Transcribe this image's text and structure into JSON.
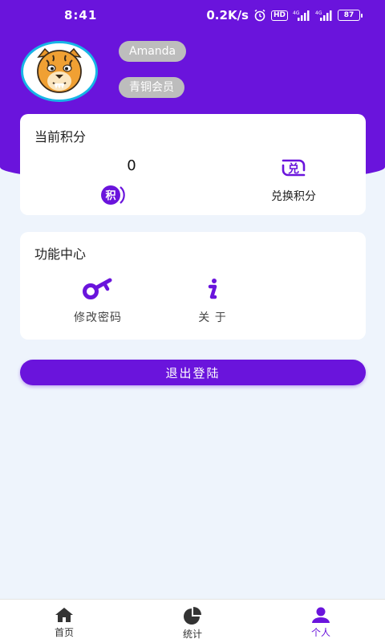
{
  "status_bar": {
    "time": "8:41",
    "network_speed": "0.2K/s",
    "hd_badge": "HD",
    "signal_labels": [
      "4G",
      "4G"
    ],
    "battery": "87"
  },
  "profile": {
    "username": "Amanda",
    "member_level": "青铜会员",
    "avatar_icon": "tiger-avatar-icon"
  },
  "points_card": {
    "title": "当前积分",
    "value": "0",
    "points_icon_text": "积",
    "redeem_icon_text": "兑",
    "redeem_label": "兑换积分"
  },
  "function_center": {
    "title": "功能中心",
    "items": [
      {
        "label": "修改密码",
        "icon": "key-icon"
      },
      {
        "label": "关 于",
        "icon": "info-icon"
      }
    ]
  },
  "logout_label": "退出登陆",
  "tabs": [
    {
      "label": "首页",
      "icon": "home-icon"
    },
    {
      "label": "统计",
      "icon": "pie-chart-icon"
    },
    {
      "label": "个人",
      "icon": "person-icon",
      "active": true
    }
  ],
  "colors": {
    "primary": "#6a14dc",
    "background": "#eef4fc",
    "pill": "#bdbdbd",
    "avatar_border": "#17b5e6"
  }
}
